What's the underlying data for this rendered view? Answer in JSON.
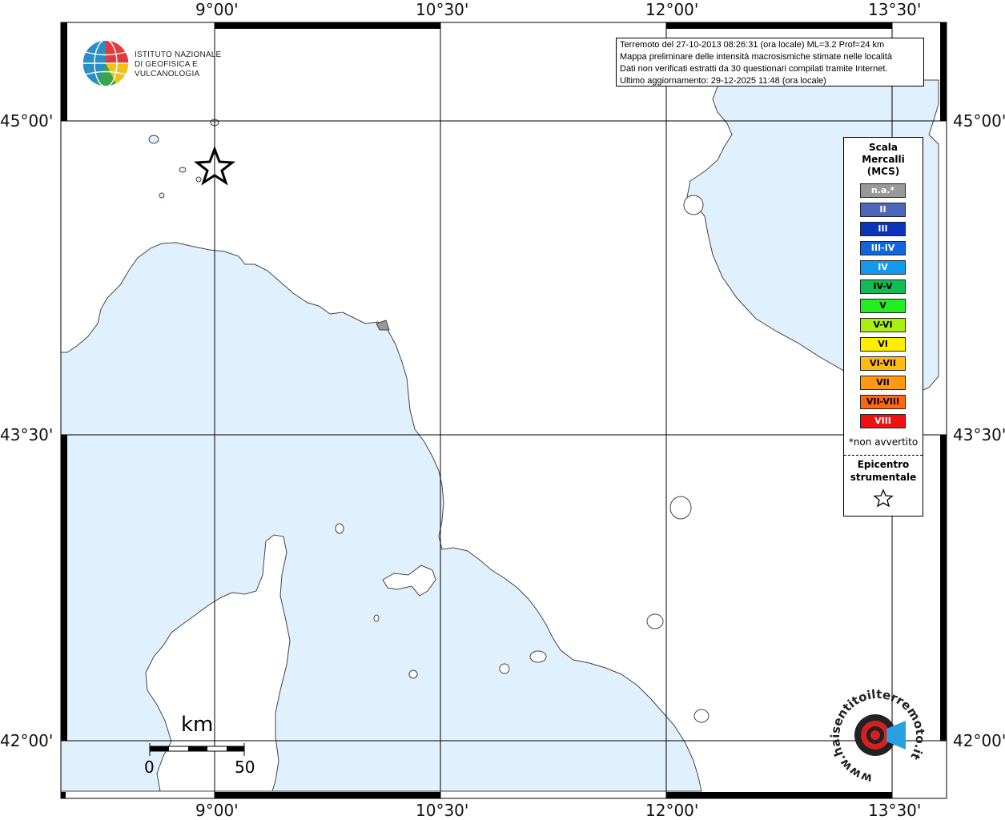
{
  "map": {
    "lon_labels": [
      "9°00'",
      "10°30'",
      "12°00'",
      "13°30'"
    ],
    "lat_labels": [
      "45°00'",
      "43°30'",
      "42°00'"
    ],
    "colors": {
      "sea": "#e0f1fd",
      "land": "#ffffff",
      "coast": "#444444",
      "grid": "#000000"
    }
  },
  "header": {
    "logo_line1": "ISTITUTO NAZIONALE",
    "logo_line2": "DI GEOFISICA E VULCANOLOGIA"
  },
  "info": {
    "line1": "Terremoto del 27-10-2013 08:26:31 (ora locale) ML=3.2 Prof=24 km",
    "line2": "Mappa preliminare delle intensità macrosismiche stimate nelle località",
    "line3": "Dati non verificati estratti da 30 questionari compilati tramite Internet.",
    "line4": "Ultimo aggiornamento: 29-12-2025 11:48 (ora locale)"
  },
  "legend": {
    "title_line1": "Scala",
    "title_line2": "Mercalli",
    "title_line3": "(MCS)",
    "items": [
      {
        "label": "n.a.*",
        "color": "#999999",
        "text_color": "#ffffff"
      },
      {
        "label": "II",
        "color": "#4c66bb",
        "text_color": "#ffffff"
      },
      {
        "label": "III",
        "color": "#0b33bb",
        "text_color": "#ffffff"
      },
      {
        "label": "III-IV",
        "color": "#1166dd",
        "text_color": "#ffffff"
      },
      {
        "label": "IV",
        "color": "#1199ee",
        "text_color": "#ffffff"
      },
      {
        "label": "IV-V",
        "color": "#11bb55",
        "text_color": "#000000"
      },
      {
        "label": "V",
        "color": "#22ee22",
        "text_color": "#000000"
      },
      {
        "label": "V-VI",
        "color": "#aaee11",
        "text_color": "#000000"
      },
      {
        "label": "VI",
        "color": "#ffee00",
        "text_color": "#000000"
      },
      {
        "label": "VI-VII",
        "color": "#ffbb11",
        "text_color": "#000000"
      },
      {
        "label": "VII",
        "color": "#ff9911",
        "text_color": "#000000"
      },
      {
        "label": "VII-VIII",
        "color": "#ff6611",
        "text_color": "#000000"
      },
      {
        "label": "VIII",
        "color": "#ee1111",
        "text_color": "#ffffff"
      }
    ],
    "note": "*non avvertito",
    "epicenter_line1": "Epicentro",
    "epicenter_line2": "strumentale"
  },
  "scale_bar": {
    "unit": "km",
    "min_label": "0",
    "max_label": "50"
  },
  "watermark": {
    "text": "www.haisentitoilterremoto.it"
  }
}
